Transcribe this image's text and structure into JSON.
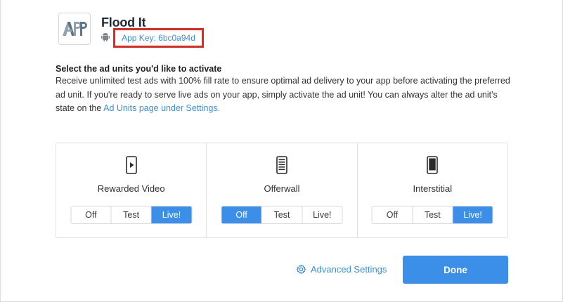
{
  "app": {
    "name": "Flood It",
    "logo_icon": "app-placeholder-logo",
    "platform_icon": "android-icon",
    "app_key": "App Key: 6bc0a94d"
  },
  "instructions": {
    "title": "Select the ad units you'd like to activate",
    "body": "Receive unlimited test ads with 100% fill rate to ensure optimal ad delivery to your app before activating the preferred ad unit. If you're ready to serve live ads on your app, simply activate the ad unit! You can always alter the ad unit's state on the ",
    "link": "Ad Units page under Settings."
  },
  "ad_units": [
    {
      "label": "Rewarded Video",
      "icon": "phone-video-icon",
      "states": [
        "Off",
        "Test",
        "Live!"
      ],
      "selected": "Live!"
    },
    {
      "label": "Offerwall",
      "icon": "phone-list-icon",
      "states": [
        "Off",
        "Test",
        "Live!"
      ],
      "selected": "Off"
    },
    {
      "label": "Interstitial",
      "icon": "phone-fullscreen-icon",
      "states": [
        "Off",
        "Test",
        "Live!"
      ],
      "selected": "Live!"
    }
  ],
  "footer": {
    "advanced_settings": "Advanced Settings",
    "done": "Done"
  },
  "colors": {
    "accent": "#3b8fe8",
    "highlight_border": "#e8261b",
    "link": "#3b8fde"
  }
}
